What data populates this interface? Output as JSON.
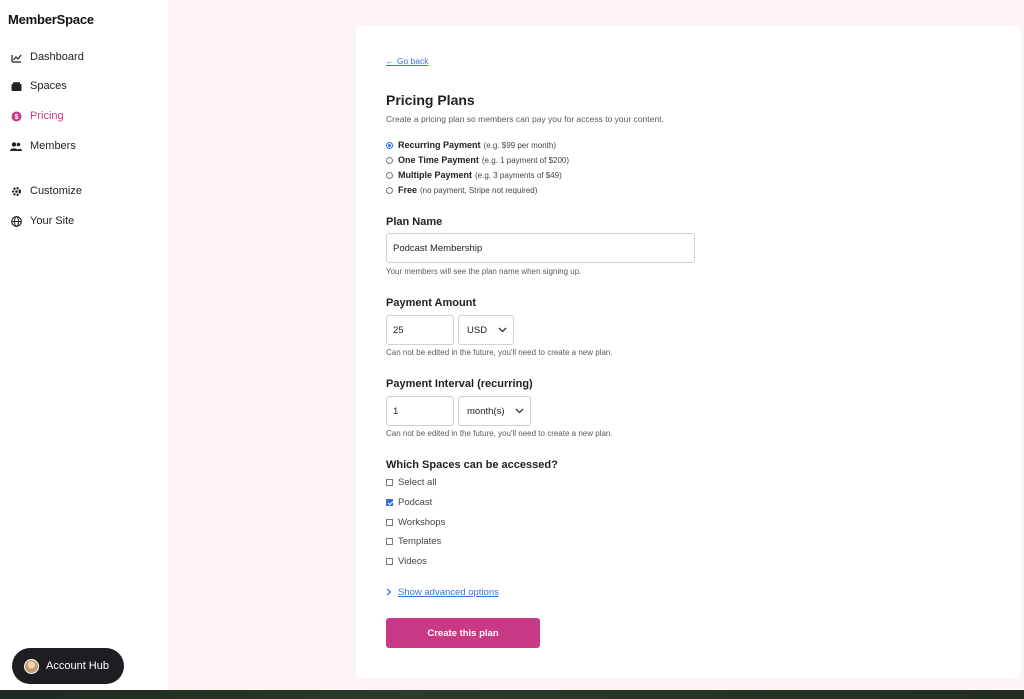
{
  "app": {
    "logo_text": "MemberSpace"
  },
  "sidebar": {
    "items": [
      {
        "label": "Dashboard",
        "icon": "chart-icon"
      },
      {
        "label": "Spaces",
        "icon": "folder-icon"
      },
      {
        "label": "Pricing",
        "icon": "dollar-icon",
        "active": true
      },
      {
        "label": "Members",
        "icon": "members-icon"
      },
      {
        "label": "Customize",
        "icon": "gear-icon"
      },
      {
        "label": "Your Site",
        "icon": "globe-icon"
      }
    ],
    "account_hub_label": "Account Hub"
  },
  "colors": {
    "accent": "#c93a86",
    "link": "#3e6fd6",
    "check": "#2f6de0"
  },
  "form": {
    "back_link": "← Go back",
    "title": "Pricing Plans",
    "description": "Create a pricing plan so members can pay you for access to your content.",
    "payment_types": [
      {
        "label": "Recurring Payment",
        "hint": "(e.g. $99 per month)",
        "checked": true
      },
      {
        "label": "One Time Payment",
        "hint": "(e.g. 1 payment of $200)",
        "checked": false
      },
      {
        "label": "Multiple Payment",
        "hint": "(e.g. 3 payments of $49)",
        "checked": false
      },
      {
        "label": "Free",
        "hint": "(no payment, Stripe not required)",
        "checked": false
      }
    ],
    "plan_name": {
      "label": "Plan Name",
      "value": "Podcast Membership",
      "helper": "Your members will see the plan name when signing up."
    },
    "payment_amount": {
      "label": "Payment Amount",
      "value": "25",
      "currency": "USD",
      "helper": "Can not be edited in the future, you'll need to create a new plan."
    },
    "payment_interval": {
      "label": "Payment Interval (recurring)",
      "value": "1",
      "unit": "month(s)",
      "helper": "Can not be edited in the future, you'll need to create a new plan."
    },
    "spaces": {
      "label": "Which Spaces can be accessed?",
      "options": [
        {
          "label": "Select all",
          "checked": false
        },
        {
          "label": "Podcast",
          "checked": true
        },
        {
          "label": "Workshops",
          "checked": false
        },
        {
          "label": "Templates",
          "checked": false
        },
        {
          "label": "Videos",
          "checked": false
        }
      ]
    },
    "advanced_label": "Show advanced options",
    "submit_label": "Create this plan"
  }
}
